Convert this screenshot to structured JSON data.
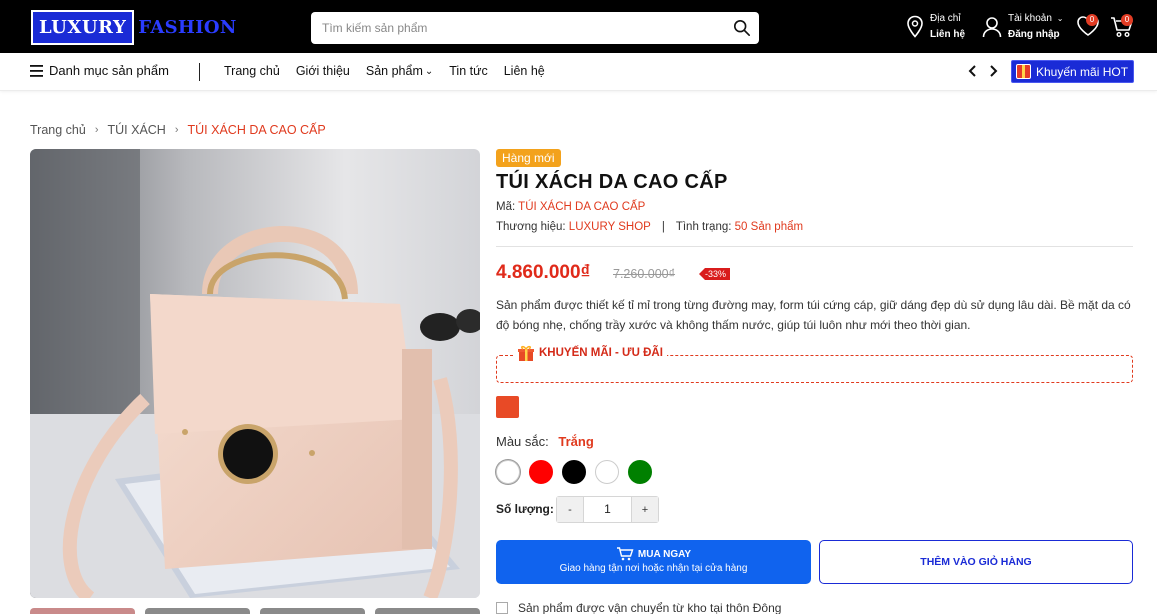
{
  "header": {
    "logo_part1": "LUXURY",
    "logo_part2": "FASHION",
    "search_placeholder": "Tìm kiếm sản phẩm",
    "address_label": "Địa chỉ",
    "address_link": "Liên hệ",
    "account_label": "Tài khoản",
    "account_link": "Đăng nhập",
    "wishlist_count": "0",
    "cart_count": "0"
  },
  "nav": {
    "category_menu": "Danh mục sản phẩm",
    "links": [
      "Trang chủ",
      "Giới thiệu",
      "Sản phẩm",
      "Tin tức",
      "Liên hệ"
    ],
    "promo_hot": "Khuyến mãi HOT"
  },
  "breadcrumb": [
    "Trang chủ",
    "TÚI XÁCH",
    "TÚI XÁCH DA CAO CẤP"
  ],
  "product": {
    "tag": "Hàng mới",
    "title": "TÚI XÁCH DA CAO CẤP",
    "sku_label": "Mã:",
    "sku_value": "TÚI XÁCH DA CAO CẤP",
    "brand_label": "Thương hiệu:",
    "brand_value": "LUXURY SHOP",
    "status_label": "Tình trạng:",
    "status_value": "50 Sản phẩm",
    "price": "4.860.000₫",
    "old_price": "7.260.000₫",
    "discount": "-33%",
    "description": "Sản phẩm được thiết kế tỉ mỉ trong từng đường may, form túi cứng cáp, giữ dáng đẹp dù sử dụng lâu dài. Bề mặt da có độ bóng nhẹ, chống trầy xước và không thấm nước, giúp túi luôn như mới theo thời gian.",
    "promo_title": "KHUYẾN MÃI - ƯU ĐÃI",
    "color_label": "Màu sắc:",
    "color_value": "Trắng",
    "colors": [
      "#ffffff",
      "#ff0000",
      "#000000",
      "#ffffff",
      "#008000"
    ],
    "variant_color": "#e84a26",
    "qty_label": "Số lượng:",
    "qty_value": "1",
    "qty_minus": "-",
    "qty_plus": "+",
    "buy_now": "MUA NGAY",
    "buy_now_sub": "Giao hàng tận nơi hoặc nhận tại cửa hàng",
    "add_to_cart": "THÊM VÀO GIỎ HÀNG",
    "shipping_note": "Sản phẩm được vận chuyển từ kho tại thôn Đông"
  },
  "colors": {
    "header_bg": "#000000",
    "brand_blue": "#1a2bd6",
    "accent_red": "#e03a1e",
    "buy_blue": "#1063ee",
    "new_tag": "#f3a21c"
  }
}
